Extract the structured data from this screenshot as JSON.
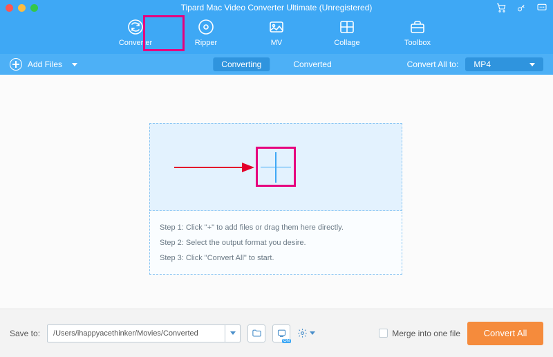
{
  "title": "Tipard Mac Video Converter Ultimate (Unregistered)",
  "nav": {
    "items": [
      {
        "label": "Converter"
      },
      {
        "label": "Ripper"
      },
      {
        "label": "MV"
      },
      {
        "label": "Collage"
      },
      {
        "label": "Toolbox"
      }
    ]
  },
  "subbar": {
    "add_files": "Add Files",
    "converting": "Converting",
    "converted": "Converted",
    "convert_all_to": "Convert All to:",
    "format": "MP4"
  },
  "steps": {
    "s1": "Step 1: Click \"+\" to add files or drag them here directly.",
    "s2": "Step 2: Select the output format you desire.",
    "s3": "Step 3: Click \"Convert All\" to start."
  },
  "footer": {
    "save_to": "Save to:",
    "path": "/Users/ihappyacethinker/Movies/Converted",
    "merge": "Merge into one file",
    "convert_all": "Convert All"
  }
}
